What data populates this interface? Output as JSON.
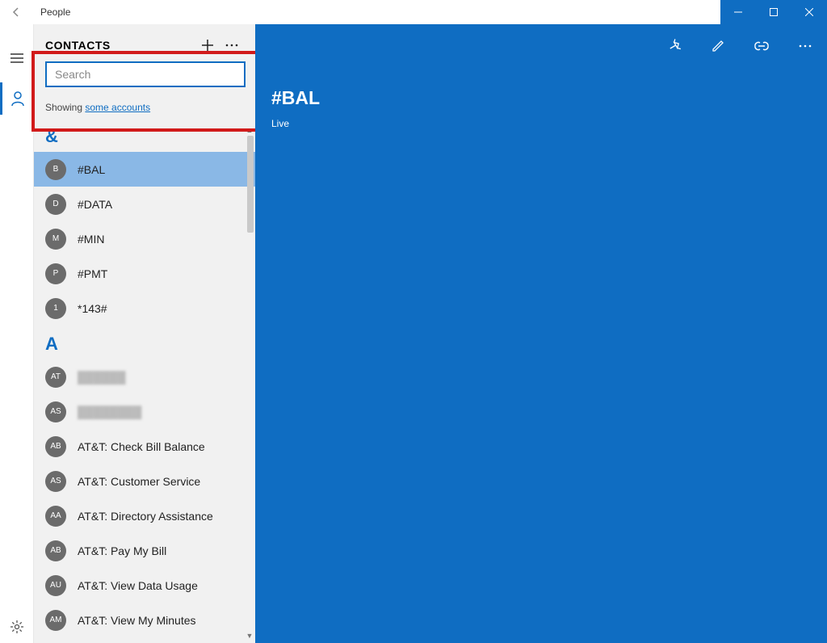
{
  "window": {
    "title": "People"
  },
  "sidebar": {
    "heading": "CONTACTS"
  },
  "search": {
    "placeholder": "Search"
  },
  "filter": {
    "prefix": "Showing ",
    "link": "some accounts"
  },
  "groups": [
    {
      "letter": "&",
      "items": [
        {
          "initials": "B",
          "name": "#BAL",
          "selected": true
        },
        {
          "initials": "D",
          "name": "#DATA"
        },
        {
          "initials": "M",
          "name": "#MIN"
        },
        {
          "initials": "P",
          "name": "#PMT"
        },
        {
          "initials": "1",
          "name": "*143#"
        }
      ]
    },
    {
      "letter": "A",
      "items": [
        {
          "initials": "AT",
          "name": "██████",
          "redacted": true
        },
        {
          "initials": "AS",
          "name": "████████",
          "redacted": true
        },
        {
          "initials": "AB",
          "name": "AT&T: Check Bill Balance"
        },
        {
          "initials": "AS",
          "name": "AT&T: Customer Service"
        },
        {
          "initials": "AA",
          "name": "AT&T: Directory Assistance"
        },
        {
          "initials": "AB",
          "name": "AT&T: Pay My Bill"
        },
        {
          "initials": "AU",
          "name": "AT&T: View Data Usage"
        },
        {
          "initials": "AM",
          "name": "AT&T: View My Minutes"
        }
      ]
    }
  ],
  "detail": {
    "name": "#BAL",
    "source": "Live"
  }
}
